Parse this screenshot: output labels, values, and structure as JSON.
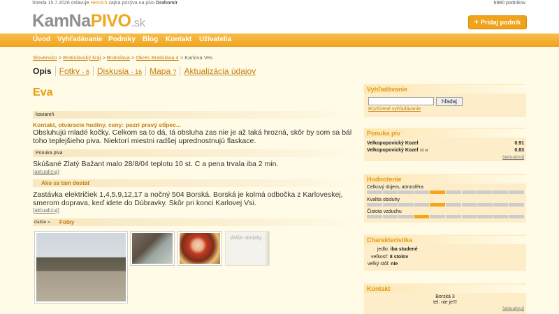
{
  "topbar": {
    "day": "Streda",
    "date": "15.7.2026",
    "celebrate_text": "oslavuje",
    "name_today": "Henrich",
    "tomorrow_text": "zajtra pozýva na pivo",
    "name_tomorrow": "Drahomír",
    "venues_count": "6980 podnikov"
  },
  "logo": {
    "kam": "KamNa",
    "pivo": "PIVO",
    "sk": ".sk"
  },
  "header": {
    "add_button": "Pridaj podnik"
  },
  "nav": [
    "Úvod",
    "Vyhľadávanie",
    "Podniky",
    "Blog",
    "Kontakt",
    "Užívatelia"
  ],
  "breadcrumb": [
    "Slovensko",
    "Bratislavský kraj",
    "Bratislava",
    "Okres Bratislava 4",
    "Karlova Ves"
  ],
  "tabs": [
    {
      "label": "Opis",
      "count": ""
    },
    {
      "label": "Fotky",
      "count": "- 6"
    },
    {
      "label": "Diskusia",
      "count": "- 16"
    },
    {
      "label": "Mapa",
      "count": "?"
    },
    {
      "label": "Aktualizácia údajov",
      "count": ""
    }
  ],
  "pub": {
    "name": "Eva",
    "type_label": "kaviareň",
    "contact_title": "Kontakt, otváracie hodiny, ceny: pozri pravý stĺpec...",
    "description": "Obsluhujú mladé kočky. Celkom sa to dá, tá obsluha zas nie je až taká hrozná, skôr by som sa bál toho teplejšieho piva. Niektorí miestni radšej uprednostnujú flaskace.",
    "beer_offer_label": "Ponuka piva",
    "beer_offer_text": "Skúšané Zlatý Bažant malo 28/8/04 teplotu 10 st. C a pena trvala iba 2 min.",
    "update_link": "aktualizuj",
    "directions_title": "Ako sa tam dostať",
    "directions_text": "Zastávka električiek 1,4,5,9,12,17 a nočný 504 Borská. Borská je kolmá odbočka z Karloveskej, smerom doprava, keď idete do Dúbravky. Skôr pri konci Karlovej Vsi.",
    "more_link": "ďalšie »",
    "photos_title": "Fotky",
    "more_photos": "ďalšie obrázky..."
  },
  "sidebar": {
    "search": {
      "title": "Vyhľadávanie",
      "button": "hľadaj",
      "advanced": "Rozšírené vyhľadávanie"
    },
    "beers": {
      "title": "Ponuka pív",
      "items": [
        {
          "name": "Velkopopovický Kozel",
          "note": "",
          "price": "0.91"
        },
        {
          "name": "Velkopopovický Kozel",
          "note": "10 st",
          "price": "0.83"
        }
      ],
      "update": "aktualizuj"
    },
    "rating": {
      "title": "Hodnotenie",
      "items": [
        {
          "label": "Celkový dojem, atmosféra",
          "value": 0.5
        },
        {
          "label": "Kvalita obsluhy",
          "value": 0.5
        },
        {
          "label": "Čistota vzduchu",
          "value": 0.4
        }
      ]
    },
    "characteristics": {
      "title": "Charakteristika",
      "rows": [
        {
          "key": "jedlo:",
          "value": "iba studené"
        },
        {
          "key": "veľkosť:",
          "value": "8 stolov"
        },
        {
          "key": "veľký stôl:",
          "value": "nie"
        }
      ]
    },
    "contact": {
      "title": "Kontakt",
      "address": "Borská 3",
      "phone": "tel: nie je!!!",
      "update": "aktualizuj"
    }
  }
}
